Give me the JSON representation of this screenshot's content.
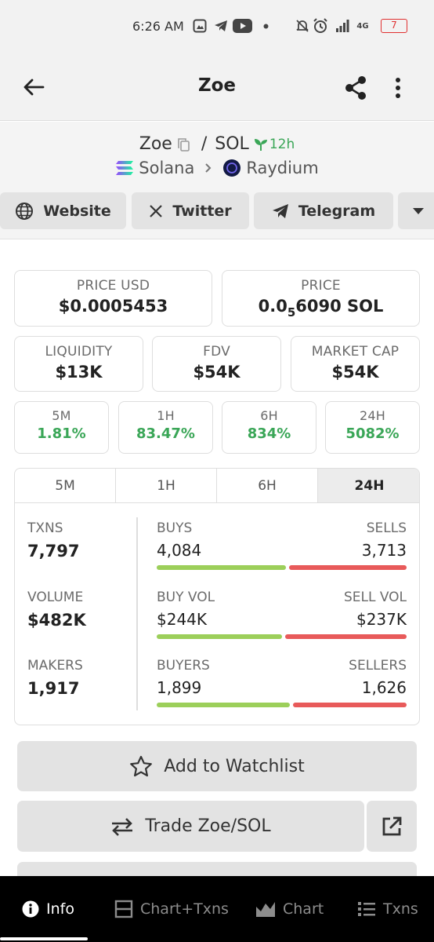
{
  "status_bar": {
    "time": "6:26 AM",
    "network": "4G",
    "battery": "7",
    "icons": [
      "gallery-icon",
      "telegram-icon",
      "youtube-icon",
      "dot-icon",
      "mute-icon",
      "alarm-icon",
      "signal-icon",
      "battery-icon"
    ]
  },
  "header": {
    "title": "Zoe",
    "icons": [
      "back-arrow-icon",
      "share-icon",
      "more-vertical-icon"
    ]
  },
  "token": {
    "base": "Zoe",
    "separator": "/",
    "quote": "SOL",
    "age": "12h",
    "chain": "Solana",
    "dex": "Raydium"
  },
  "links": [
    {
      "label": "Website",
      "icon": "globe-icon"
    },
    {
      "label": "Twitter",
      "icon": "x-icon"
    },
    {
      "label": "Telegram",
      "icon": "telegram-icon"
    },
    {
      "label": "",
      "icon": "chevron-down-icon"
    }
  ],
  "price": {
    "usd_label": "PRICE USD",
    "usd_value": "$0.0005453",
    "native_label": "PRICE",
    "native_prefix": "0.0",
    "native_zeros": "5",
    "native_digits": "6090",
    "native_unit": "SOL"
  },
  "metrics": [
    {
      "label": "LIQUIDITY",
      "value": "$13K"
    },
    {
      "label": "FDV",
      "value": "$54K"
    },
    {
      "label": "MARKET CAP",
      "value": "$54K"
    }
  ],
  "changes": [
    {
      "label": "5M",
      "value": "1.81%"
    },
    {
      "label": "1H",
      "value": "83.47%"
    },
    {
      "label": "6H",
      "value": "834%"
    },
    {
      "label": "24H",
      "value": "5082%"
    }
  ],
  "colors": {
    "positive": "#3aa657",
    "buy_bar": "#9ccf5a",
    "sell_bar": "#e85a5a"
  },
  "txn_panel": {
    "tabs": [
      "5M",
      "1H",
      "6H",
      "24H"
    ],
    "active_tab": "24H",
    "txns": {
      "label": "TXNS",
      "value": "7,797"
    },
    "volume": {
      "label": "VOLUME",
      "value": "$482K"
    },
    "makers": {
      "label": "MAKERS",
      "value": "1,917"
    },
    "buys": {
      "label": "BUYS",
      "value": "4,084",
      "share": 0.524
    },
    "sells": {
      "label": "SELLS",
      "value": "3,713"
    },
    "buy_vol": {
      "label": "BUY VOL",
      "value": "$244K",
      "share": 0.507
    },
    "sell_vol": {
      "label": "SELL VOL",
      "value": "$237K"
    },
    "buyers": {
      "label": "BUYERS",
      "value": "1,899",
      "share": 0.539
    },
    "sellers": {
      "label": "SELLERS",
      "value": "1,626"
    }
  },
  "actions": {
    "watchlist": "Add to Watchlist",
    "trade": "Trade Zoe/SOL"
  },
  "bottom_nav": [
    {
      "label": "Info",
      "icon": "info-icon",
      "active": true
    },
    {
      "label": "Chart+Txns",
      "icon": "split-view-icon",
      "active": false
    },
    {
      "label": "Chart",
      "icon": "area-chart-icon",
      "active": false
    },
    {
      "label": "Txns",
      "icon": "list-icon",
      "active": false
    }
  ]
}
